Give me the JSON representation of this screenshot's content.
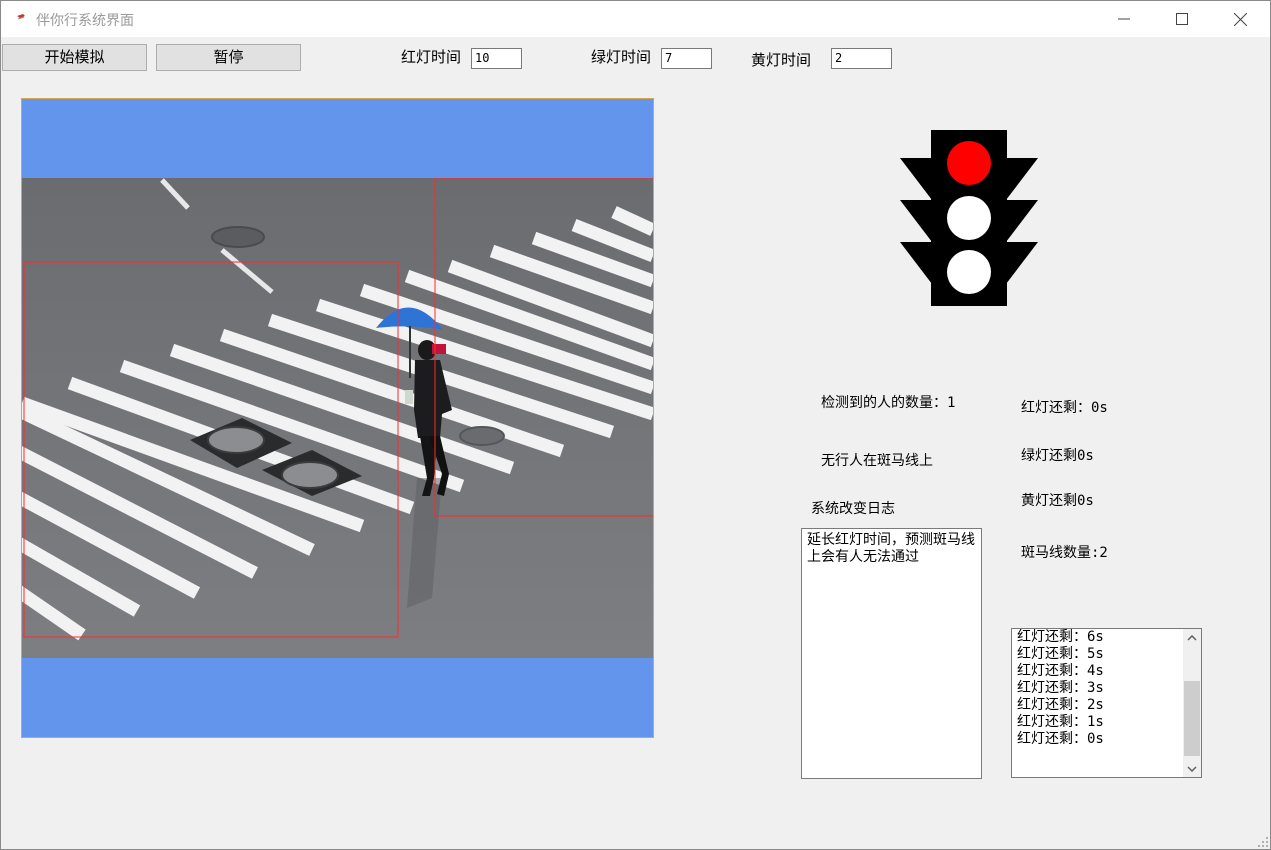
{
  "window": {
    "title": "伴你行系统界面"
  },
  "toolbar": {
    "start_label": "开始模拟",
    "pause_label": "暂停",
    "red_time_label": "红灯时间",
    "red_time_value": "10",
    "green_time_label": "绿灯时间",
    "green_time_value": "7",
    "yellow_time_label": "黄灯时间",
    "yellow_time_value": "2"
  },
  "traffic_light": {
    "active": "red",
    "red_color": "#ff0000",
    "off_color": "#ffffff",
    "body_color": "#000000"
  },
  "status": {
    "people_count": "检测到的人的数量：1",
    "zebra_status": "无行人在斑马线上",
    "log_title": "系统改变日志",
    "red_remaining": "红灯还剩：0s",
    "green_remaining": "绿灯还剩0s",
    "yellow_remaining": "黄灯还剩0s",
    "zebra_count": "斑马线数量:2"
  },
  "log": {
    "text": "延长红灯时间，预测斑马线上会有人无法通过"
  },
  "countdown_list": [
    "红灯还剩：6s",
    "红灯还剩：5s",
    "红灯还剩：4s",
    "红灯还剩：3s",
    "红灯还剩：2s",
    "红灯还剩：1s",
    "红灯还剩：0s"
  ],
  "colors": {
    "canvas_bg": "#6495ed",
    "detection_box": "#ff2a2a"
  }
}
